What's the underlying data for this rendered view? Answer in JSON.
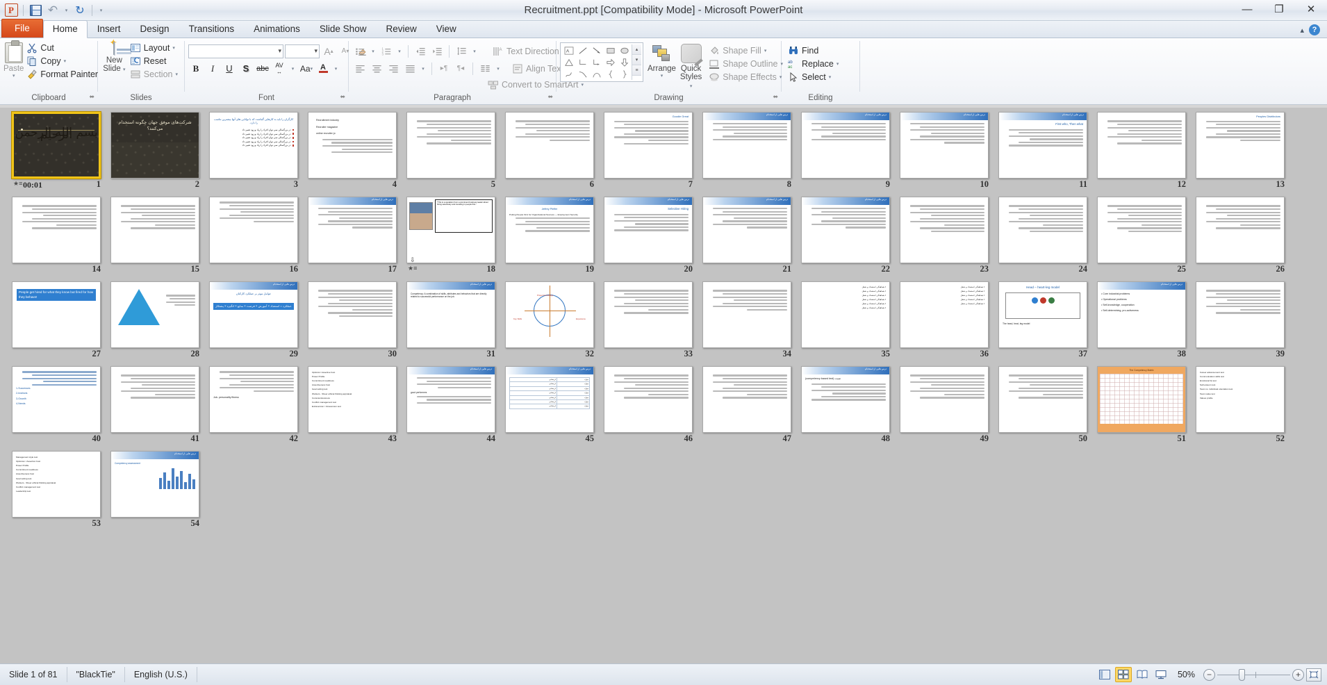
{
  "window": {
    "title": "Recruitment.ppt [Compatibility Mode]  -  Microsoft PowerPoint",
    "minimize": "—",
    "restore": "❐",
    "close": "✕"
  },
  "quick_access": {
    "app_logo": "P",
    "save": "save-icon",
    "undo": "↶",
    "undo_caret": "▾",
    "redo": "↻",
    "customize_caret": "▾"
  },
  "tabs": [
    {
      "label": "File",
      "type": "file"
    },
    {
      "label": "Home",
      "type": "active"
    },
    {
      "label": "Insert",
      "type": "normal"
    },
    {
      "label": "Design",
      "type": "normal"
    },
    {
      "label": "Transitions",
      "type": "normal"
    },
    {
      "label": "Animations",
      "type": "normal"
    },
    {
      "label": "Slide Show",
      "type": "normal"
    },
    {
      "label": "Review",
      "type": "normal"
    },
    {
      "label": "View",
      "type": "normal"
    }
  ],
  "tab_right": {
    "minimize_ribbon": "▴",
    "help": "?"
  },
  "ribbon": {
    "clipboard": {
      "label": "Clipboard",
      "paste": "Paste",
      "paste_caret": "▾",
      "cut": "Cut",
      "copy": "Copy",
      "copy_caret": "▾",
      "format_painter": "Format Painter",
      "dialog_launcher": "⬌"
    },
    "slides": {
      "label": "Slides",
      "new_slide": "New\nSlide",
      "new_slide_line1": "New",
      "new_slide_line2": "Slide",
      "new_slide_caret": "▾",
      "layout": "Layout",
      "layout_caret": "▾",
      "reset": "Reset",
      "section": "Section",
      "section_caret": "▾"
    },
    "font": {
      "label": "Font",
      "font_name": "",
      "font_size": "",
      "grow": "A",
      "shrink": "A",
      "clear_formatting": "⬚",
      "bold": "B",
      "italic": "I",
      "underline": "U",
      "shadow": "S",
      "strikethrough": "abc",
      "char_spacing": "AV",
      "change_case": "Aa",
      "font_color": "A",
      "dialog_launcher": "⬌"
    },
    "paragraph": {
      "label": "Paragraph",
      "bullets": "≡",
      "numbering": "≡",
      "decrease_indent": "⇤",
      "increase_indent": "⇥",
      "line_spacing": "↕",
      "align_left": "≡",
      "align_center": "≡",
      "align_right": "≡",
      "justify": "≡",
      "ltr": "▸¶",
      "rtl": "¶◂",
      "columns": "‖",
      "text_direction": "Text Direction",
      "align_text": "Align Text",
      "convert_smartart": "Convert to SmartArt",
      "dialog_launcher": "⬌"
    },
    "drawing": {
      "label": "Drawing",
      "arrange": "Arrange",
      "arrange_caret": "▾",
      "quick_styles_line1": "Quick",
      "quick_styles_line2": "Styles",
      "quick_styles_caret": "▾",
      "shape_fill": "Shape Fill",
      "shape_outline": "Shape Outline",
      "shape_effects": "Shape Effects",
      "gallery_up": "▴",
      "gallery_down": "▾",
      "gallery_more": "≡",
      "dialog_launcher": "⬌"
    },
    "editing": {
      "label": "Editing",
      "find": "Find",
      "replace": "Replace",
      "replace_caret": "▾",
      "select": "Select",
      "select_caret": "▾"
    }
  },
  "slide_sorter": {
    "selected_slide": 1,
    "slide1_timer": "00:01",
    "slide1_anim_icon": "animation-star-icon",
    "slide18_anim_icon": "animation-star-icon",
    "slides": [
      {
        "n": 1,
        "kind": "dark-title",
        "title": "",
        "lines": [],
        "timer": "00:01",
        "anim": true
      },
      {
        "n": 2,
        "kind": "dark-heading",
        "title_rtl": "شرکت‌های موفق جهان چگونه استخدام می‌کنند؟"
      },
      {
        "n": 3,
        "kind": "rtl-bullets",
        "heading_rtl": "کارگران را باید به کارهایی گماشت که با توانایی های آنها بیشترین تناسب را دارد.",
        "bullets": 5
      },
      {
        "n": 4,
        "kind": "en-list",
        "items": [
          "Recruitment industry",
          "Recruiter magazine",
          "online recruiter jo"
        ]
      },
      {
        "n": 5,
        "kind": "rtl-text",
        "lines": 8
      },
      {
        "n": 6,
        "kind": "rtl-text",
        "lines": 7
      },
      {
        "n": 7,
        "kind": "rtl-text-en",
        "en_title": "Goodie Great",
        "lines": 8
      },
      {
        "n": 8,
        "kind": "header-rtl",
        "lines": 6
      },
      {
        "n": 9,
        "kind": "header-rtl",
        "lines": 6
      },
      {
        "n": 10,
        "kind": "header-rtl",
        "lines": 7
      },
      {
        "n": 11,
        "kind": "en-heading",
        "en_title": "First who, Then what",
        "lines": 6
      },
      {
        "n": 12,
        "kind": "rtl-text",
        "lines": 8
      },
      {
        "n": 13,
        "kind": "rtl-text-en",
        "en_title": "Peoples Distributors",
        "lines": 7
      },
      {
        "n": 14,
        "kind": "rtl-text",
        "lines": 8
      },
      {
        "n": 15,
        "kind": "rtl-text",
        "lines": 8
      },
      {
        "n": 16,
        "kind": "rtl-text-en",
        "en_title": "",
        "lines": 7
      },
      {
        "n": 17,
        "kind": "header-rtl",
        "lines": 7
      },
      {
        "n": 18,
        "kind": "photo-quote",
        "anim": true
      },
      {
        "n": 19,
        "kind": "en-quote",
        "en_title": "Jeffrey Pfeffer",
        "lines": 8
      },
      {
        "n": 20,
        "kind": "en-heading",
        "en_title": "Selective Hiring",
        "lines": 6
      },
      {
        "n": 21,
        "kind": "header-rtl",
        "lines": 7
      },
      {
        "n": 22,
        "kind": "header-rtl",
        "lines": 7
      },
      {
        "n": 23,
        "kind": "rtl-text",
        "lines": 9
      },
      {
        "n": 24,
        "kind": "rtl-text",
        "lines": 9
      },
      {
        "n": 25,
        "kind": "rtl-text",
        "lines": 9
      },
      {
        "n": 26,
        "kind": "rtl-text",
        "lines": 8
      },
      {
        "n": 27,
        "kind": "quote-blue",
        "quote": "People get hired for what they know but fired for how they behave!"
      },
      {
        "n": 28,
        "kind": "pyramid",
        "lines": 4
      },
      {
        "n": 29,
        "kind": "header-rtl-hl",
        "heading_rtl": "عوامل موثر بر عملکرد کارکنان",
        "hl": "عملکرد = استعداد × آموزش × فرصت × منابع × انگیزه × پشتکار"
      },
      {
        "n": 30,
        "kind": "rtl-text",
        "lines": 9
      },
      {
        "n": 31,
        "kind": "en-def",
        "en_title": "Competency: A combination of skills, attributes and behaviors that are directly related to successful performance on the job."
      },
      {
        "n": 32,
        "kind": "diagram-circle",
        "labels": [
          "Project Knowledge",
          "Key Skills",
          "Experience"
        ]
      },
      {
        "n": 33,
        "kind": "rtl-text",
        "lines": 8
      },
      {
        "n": 34,
        "kind": "rtl-text",
        "lines": 7
      },
      {
        "n": 35,
        "kind": "rtl-bullets2",
        "lines": 6
      },
      {
        "n": 36,
        "kind": "rtl-bullets3",
        "lines": 5
      },
      {
        "n": 37,
        "kind": "head-heart",
        "en_title": "Head – heart-leg model",
        "caption": "The head, heat, leg model"
      },
      {
        "n": 38,
        "kind": "en-bullets",
        "items": [
          "Core industrial problems",
          "Operational problems",
          "Self-knowledge, cooperation",
          "Self-determining, pro-activeness"
        ]
      },
      {
        "n": 39,
        "kind": "rtl-text",
        "lines": 8
      },
      {
        "n": 40,
        "kind": "en-num-list",
        "items": [
          "1-Successes",
          "2-Instincts",
          "3-Growth",
          "4-Needs"
        ]
      },
      {
        "n": 41,
        "kind": "rtl-text",
        "lines": 8
      },
      {
        "n": 42,
        "kind": "rtl-job-fit",
        "caption": "Job- personality fitness"
      },
      {
        "n": 43,
        "kind": "en-list2",
        "items": [
          "Optimist / Assertive host",
          "Power Profile",
          "Commitment readiness",
          "Assertiveness host",
          "Goal setting test",
          "Workers - Sheer ethical thinking appraisal",
          "Conscientiousness",
          "Conflict management test",
          "Extraversion / Intraversion test"
        ]
      },
      {
        "n": 44,
        "kind": "en-list3",
        "items": [
          "good performers"
        ]
      },
      {
        "n": 45,
        "kind": "rtl-table",
        "rows": 7
      },
      {
        "n": 46,
        "kind": "rtl-text",
        "lines": 8
      },
      {
        "n": 47,
        "kind": "rtl-text",
        "lines": 8
      },
      {
        "n": 48,
        "kind": "en-heading2",
        "en_title": "(competency based test) تست",
        "lines": 6
      },
      {
        "n": 49,
        "kind": "rtl-text",
        "lines": 8
      },
      {
        "n": 50,
        "kind": "rtl-text",
        "lines": 8
      },
      {
        "n": 51,
        "kind": "orange-matrix",
        "en_title": "The Competency Matrix"
      },
      {
        "n": 52,
        "kind": "en-list4",
        "items": [
          "Career advancement test",
          "Communication skills test",
          "Emotional IQ test",
          "Self-esteem test",
          "Team vs. individual orientation test",
          "Team value test",
          "Values profile"
        ]
      },
      {
        "n": 53,
        "kind": "en-list5",
        "items": [
          "Management style test",
          "Optimism / Assertion host",
          "Power Profile",
          "Commitment readiness",
          "Assertiveness host",
          "Goal setting test",
          "Workers - Sheer ethical thinking appraisal",
          "Conflict management test",
          "Leadership test"
        ]
      },
      {
        "n": 54,
        "kind": "bar-chart",
        "en_title": "Competency assessment"
      }
    ]
  },
  "status_bar": {
    "slide_info": "Slide 1 of 81",
    "theme": "\"BlackTie\"",
    "language": "English (U.S.)",
    "views": [
      {
        "name": "normal-view-button",
        "glyph": "▤",
        "active": false
      },
      {
        "name": "slide-sorter-view-button",
        "glyph": "▦",
        "active": true
      },
      {
        "name": "reading-view-button",
        "glyph": "▧",
        "active": false
      },
      {
        "name": "slide-show-button",
        "glyph": "❐",
        "active": false
      }
    ],
    "zoom_level": "50%",
    "zoom_out": "−",
    "zoom_in": "+",
    "fit_to_window": "⬚"
  }
}
